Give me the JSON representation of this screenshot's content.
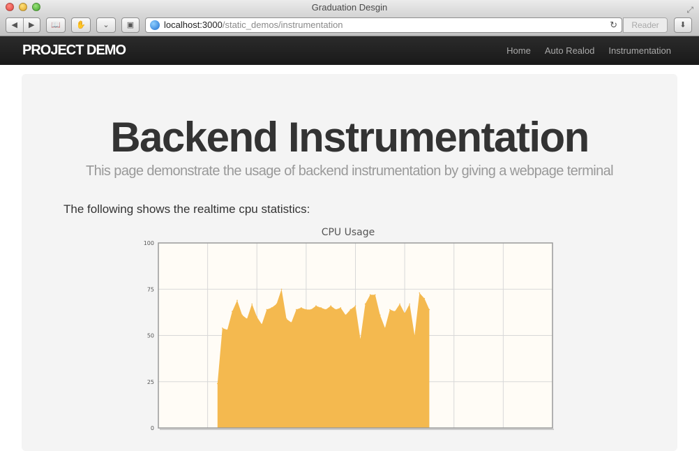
{
  "window": {
    "title": "Graduation Desgin"
  },
  "toolbar": {
    "url_host": "localhost:3000",
    "url_path": "/static_demos/instrumentation",
    "reader_label": "Reader"
  },
  "navbar": {
    "brand": "PROJECT DEMO",
    "links": [
      "Home",
      "Auto Realod",
      "Instrumentation"
    ]
  },
  "hero": {
    "headline": "Backend Instrumentation",
    "subheadline": "This page demonstrate the usage of backend instrumentation by giving a webpage terminal",
    "intro": "The following shows the realtime cpu statistics:"
  },
  "colors": {
    "area_fill": "#f4b94f",
    "plot_bg": "#fffcf6",
    "grid": "#d8d8d8",
    "navbar_bg": "#222222"
  },
  "chart_data": {
    "type": "area",
    "title": "CPU Usage",
    "xlabel": "",
    "ylabel": "",
    "ylim": [
      0,
      100
    ],
    "yticks": [
      0,
      25,
      50,
      75,
      100
    ],
    "grid": true,
    "legend": "none",
    "x": [
      0,
      1,
      2,
      3,
      4,
      5,
      6,
      7,
      8,
      9,
      10,
      11,
      12,
      13,
      14,
      15,
      16,
      17,
      18,
      19,
      20,
      21,
      22,
      23,
      24,
      25,
      26,
      27,
      28,
      29,
      30,
      31,
      32,
      33,
      34,
      35,
      36,
      37,
      38,
      39,
      40,
      41,
      42,
      43,
      44,
      45,
      46,
      47,
      48,
      49,
      50,
      51,
      52,
      53,
      54,
      55,
      56,
      57,
      58,
      59,
      60,
      61,
      62,
      63,
      64,
      65,
      66,
      67,
      68,
      69,
      70,
      71,
      72,
      73,
      74,
      75,
      76,
      77,
      78,
      79,
      80
    ],
    "series": [
      {
        "values": [
          null,
          null,
          null,
          null,
          null,
          null,
          null,
          null,
          null,
          null,
          null,
          null,
          24,
          54,
          53,
          63,
          69,
          61,
          59,
          67,
          60,
          56,
          64,
          65,
          67,
          75,
          59,
          57,
          64,
          65,
          64,
          64,
          66,
          65,
          64,
          66,
          64,
          65,
          61,
          64,
          66,
          48,
          67,
          72,
          72,
          61,
          54,
          64,
          63,
          67,
          62,
          67,
          50,
          73,
          70,
          64,
          null,
          null,
          null,
          null,
          null,
          null,
          null,
          null,
          null,
          null,
          null,
          null,
          null,
          null,
          null,
          null,
          null,
          null,
          null,
          null,
          null,
          null,
          null,
          null,
          null
        ]
      }
    ]
  }
}
